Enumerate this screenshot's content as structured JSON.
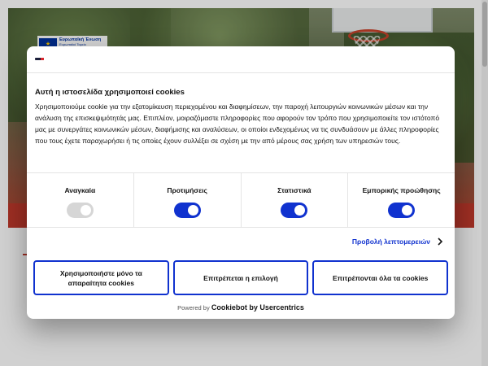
{
  "eu_badge": {
    "title": "Ευρωπαϊκή Ένωση",
    "subtitle": "Ευρωπαϊκό Ταμείο Περιφερειακής Ανάπτυξης"
  },
  "cookie_dialog": {
    "title": "Αυτή η ιστοσελίδα χρησιμοποιεί cookies",
    "body": "Χρησιμοποιούμε cookie για την εξατομίκευση περιεχομένου και διαφημίσεων, την παροχή λειτουργιών κοινωνικών μέσων και την ανάλυση της επισκεψιμότητάς μας. Επιπλέον, μοιραζόμαστε πληροφορίες που αφορούν τον τρόπο που χρησιμοποιείτε τον ιστότοπό μας με συνεργάτες κοινωνικών μέσων, διαφήμισης και αναλύσεων, οι οποίοι ενδεχομένως να τις συνδυάσουν με άλλες πληροφορίες που τους έχετε παραχωρήσει ή τις οποίες έχουν συλλέξει σε σχέση με την από μέρους σας χρήση των υπηρεσιών τους.",
    "categories": [
      {
        "label": "Αναγκαία",
        "enabled": true,
        "locked": true
      },
      {
        "label": "Προτιμήσεις",
        "enabled": true,
        "locked": false
      },
      {
        "label": "Στατιστικά",
        "enabled": true,
        "locked": false
      },
      {
        "label": "Εμπορικής προώθησης",
        "enabled": true,
        "locked": false
      }
    ],
    "details_link": "Προβολή λεπτομερειών",
    "buttons": {
      "necessary_only": "Χρησιμοποιήστε μόνο τα απαραίτητα cookies",
      "allow_selection": "Επιτρέπεται η επιλογή",
      "allow_all": "Επιτρέπονται όλα τα cookies"
    },
    "powered_by_prefix": "Powered by",
    "powered_by_brand": "Cookiebot by Usercentrics"
  },
  "colors": {
    "accent": "#1032cf",
    "toggle_disabled": "#d6d6d6",
    "brand_red": "#d9272e"
  },
  "icons": [
    "cookiebot-logo-icon",
    "chevron-right-icon",
    "eu-flag-icon"
  ]
}
